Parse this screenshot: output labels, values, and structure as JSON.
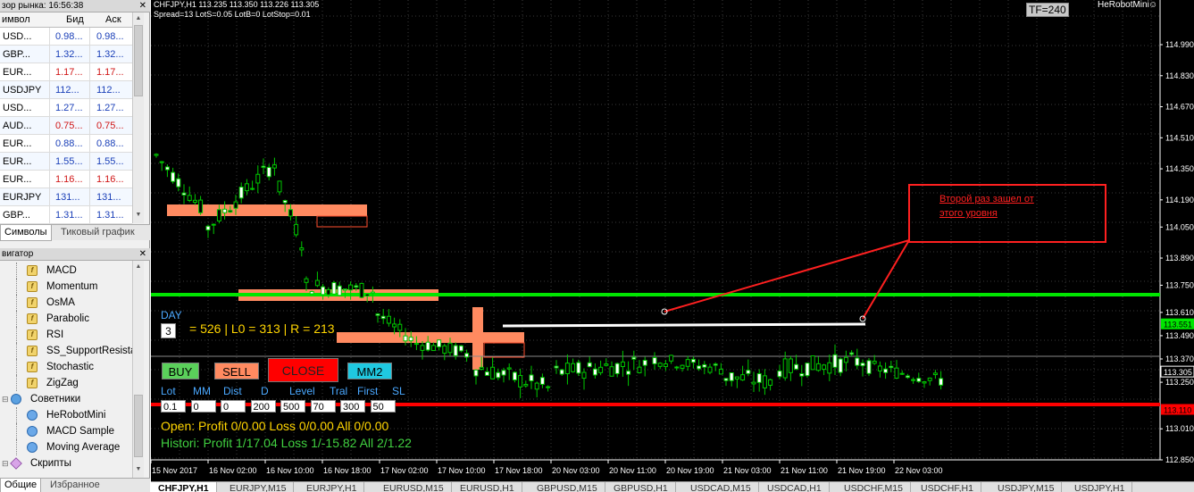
{
  "market_watch": {
    "title": "зор рынка: 16:56:38",
    "col_symbol": "имвол",
    "col_bid": "Бид",
    "col_ask": "Аск",
    "rows": [
      {
        "symbol": "USD...",
        "bid": "0.98...",
        "ask": "0.98...",
        "dir": "up"
      },
      {
        "symbol": "GBP...",
        "bid": "1.32...",
        "ask": "1.32...",
        "dir": "up"
      },
      {
        "symbol": "EUR...",
        "bid": "1.17...",
        "ask": "1.17...",
        "dir": "down"
      },
      {
        "symbol": "USDJPY",
        "bid": "112...",
        "ask": "112...",
        "dir": "up"
      },
      {
        "symbol": "USD...",
        "bid": "1.27...",
        "ask": "1.27...",
        "dir": "up"
      },
      {
        "symbol": "AUD...",
        "bid": "0.75...",
        "ask": "0.75...",
        "dir": "down"
      },
      {
        "symbol": "EUR...",
        "bid": "0.88...",
        "ask": "0.88...",
        "dir": "up"
      },
      {
        "symbol": "EUR...",
        "bid": "1.55...",
        "ask": "1.55...",
        "dir": "up"
      },
      {
        "symbol": "EUR...",
        "bid": "1.16...",
        "ask": "1.16...",
        "dir": "down"
      },
      {
        "symbol": "EURJPY",
        "bid": "131...",
        "ask": "131...",
        "dir": "up"
      },
      {
        "symbol": "GBP...",
        "bid": "1.31...",
        "ask": "1.31...",
        "dir": "up"
      }
    ],
    "tab_symbols": "Символы",
    "tab_tick": "Тиковый график"
  },
  "navigator": {
    "title": "вигатор",
    "items": [
      {
        "label": "MACD",
        "kind": "ind",
        "indent": 1
      },
      {
        "label": "Momentum",
        "kind": "ind",
        "indent": 1
      },
      {
        "label": "OsMA",
        "kind": "ind",
        "indent": 1
      },
      {
        "label": "Parabolic",
        "kind": "ind",
        "indent": 1
      },
      {
        "label": "RSI",
        "kind": "ind",
        "indent": 1
      },
      {
        "label": "SS_SupportResista",
        "kind": "ind",
        "indent": 1
      },
      {
        "label": "Stochastic",
        "kind": "ind",
        "indent": 1
      },
      {
        "label": "ZigZag",
        "kind": "ind",
        "indent": 1
      },
      {
        "label": "Советники",
        "kind": "group",
        "indent": 0
      },
      {
        "label": "HeRobotMini",
        "kind": "robot",
        "indent": 1
      },
      {
        "label": "MACD Sample",
        "kind": "robot",
        "indent": 1
      },
      {
        "label": "Moving Average",
        "kind": "robot",
        "indent": 1
      },
      {
        "label": "Скрипты",
        "kind": "script",
        "indent": 0
      }
    ],
    "tab_common": "Общие",
    "tab_fav": "Избранное"
  },
  "chart": {
    "header": "CHFJPY,H1  113.235 113.350 113.226 113.305",
    "info": "Spread=13  LotS=0.05  LotB=0  LotStop=0.01",
    "tf_badge": "TF=240",
    "ea_name": "HeRobotMini",
    "colors": {
      "bg": "#000000",
      "up": "#00c800",
      "grid": "#3a3a3a",
      "level_green": "#00e600",
      "level_red": "#ff0000",
      "zone": "#ff8a60",
      "panel_border": "#ff2020"
    },
    "annotation_text_line1": "Второй раз зашел от",
    "annotation_text_line2": "этого уровня",
    "price_labels": [
      "114.990",
      "114.830",
      "114.670",
      "114.510",
      "114.350",
      "114.190",
      "114.050",
      "113.890",
      "113.750",
      "113.610",
      "113.551",
      "113.490",
      "113.370",
      "113.305",
      "113.250",
      "113.110",
      "113.010",
      "112.850"
    ],
    "time_labels": [
      "15 Nov 2017",
      "16 Nov 02:00",
      "16 Nov 10:00",
      "16 Nov 18:00",
      "17 Nov 02:00",
      "17 Nov 10:00",
      "17 Nov 18:00",
      "20 Nov 03:00",
      "20 Nov 11:00",
      "20 Nov 19:00",
      "21 Nov 03:00",
      "21 Nov 11:00",
      "21 Nov 19:00",
      "22 Nov 03:00"
    ],
    "day_label": "DAY",
    "day_value": "3",
    "day_stats": "= 526 | L0 = 313 | R = 213",
    "btn_buy": "BUY",
    "btn_sell": "SELL",
    "btn_close": "CLOSE",
    "btn_mm2": "MM2",
    "params": [
      {
        "label": "Lot",
        "value": "0.1"
      },
      {
        "label": "MM",
        "value": "0"
      },
      {
        "label": "Dist",
        "value": "0"
      },
      {
        "label": "D",
        "value": "200"
      },
      {
        "label": "Level",
        "value": "500"
      },
      {
        "label": "Tral",
        "value": "70"
      },
      {
        "label": "First",
        "value": "300"
      },
      {
        "label": "SL",
        "value": "50"
      }
    ],
    "open_line": "Open:  Profit 0/0.00  Loss 0/0.00   All 0/0.00",
    "hist_line": "Histori: Profit 1/17.04  Loss 1/-15.82  All 2/1.22"
  },
  "bottom_tabs": [
    "CHFJPY,H1",
    "EURJPY,M15",
    "EURJPY,H1",
    "EURUSD,M15",
    "EURUSD,H1",
    "GBPUSD,M15",
    "GBPUSD,H1",
    "USDCAD,M15",
    "USDCAD,H1",
    "USDCHF,M15",
    "USDCHF,H1",
    "USDJPY,M15",
    "USDJPY,H1"
  ]
}
